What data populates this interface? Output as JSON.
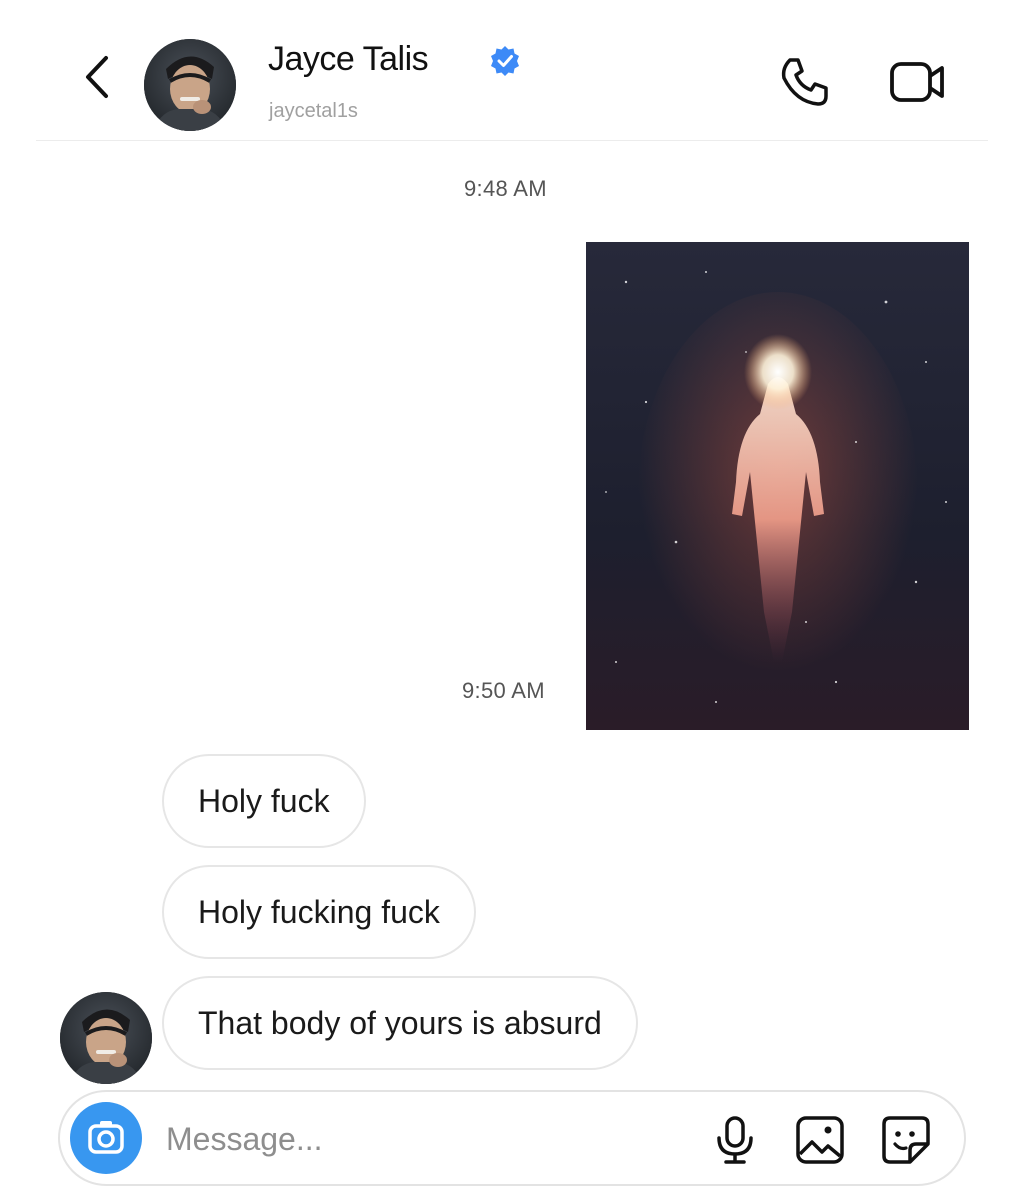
{
  "header": {
    "display_name": "Jayce Talis",
    "username": "jaycetal1s",
    "verified": true,
    "icons": {
      "back": "chevron-left-icon",
      "call": "phone-icon",
      "video": "video-camera-icon",
      "verified": "verified-badge-icon"
    }
  },
  "thread": {
    "timestamps": [
      "9:48 AM",
      "9:50 AM"
    ],
    "sent_photo": {
      "description_icon": "glowing-figure-in-space-photo"
    },
    "received_messages": [
      "Holy fuck",
      "Holy fucking fuck",
      "That body of yours is absurd"
    ]
  },
  "composer": {
    "placeholder": "Message...",
    "value": "",
    "icons": {
      "camera": "camera-icon",
      "mic": "microphone-icon",
      "gallery": "image-icon",
      "sticker": "sticker-icon"
    }
  },
  "colors": {
    "accent": "#3897f0",
    "verified": "#3d8af7",
    "bubble_border": "#e6e6e6",
    "timestamp": "#555555"
  }
}
